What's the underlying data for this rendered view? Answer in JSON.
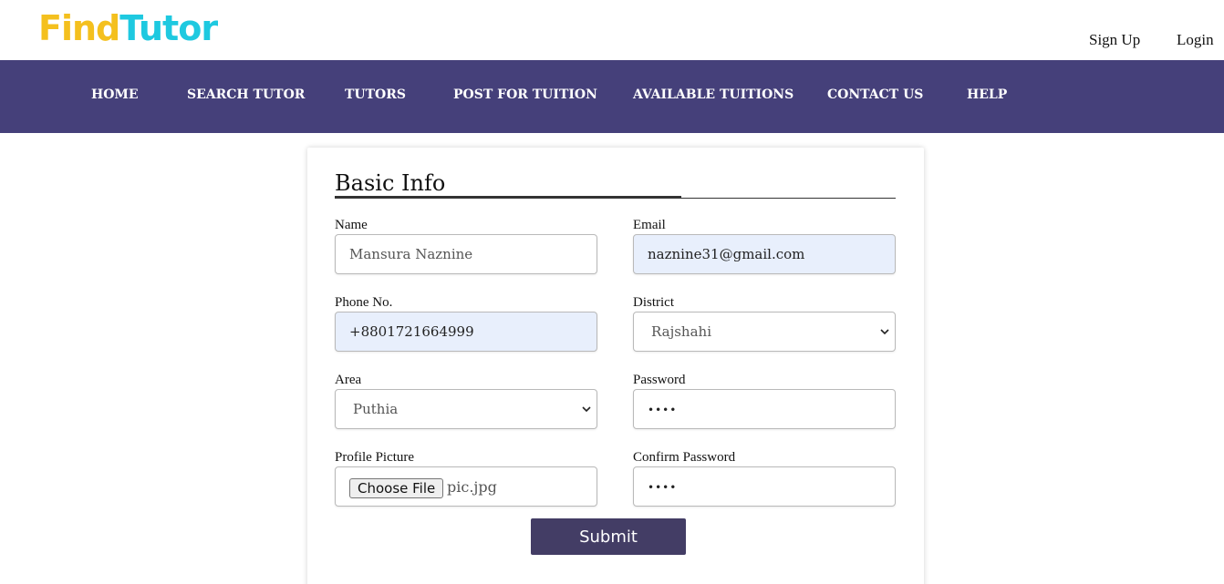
{
  "brand": {
    "part1": "Find",
    "part2": "Tutor"
  },
  "auth": {
    "signup": "Sign Up",
    "login": "Login"
  },
  "nav": [
    "HOME",
    "SEARCH TUTOR",
    "TUTORS",
    "POST FOR TUITION",
    "AVAILABLE TUITIONS",
    "CONTACT US",
    "HELP"
  ],
  "form": {
    "title": "Basic Info",
    "name": {
      "label": "Name",
      "value": "Mansura Naznine"
    },
    "email": {
      "label": "Email",
      "value": "naznine31@gmail.com"
    },
    "phone": {
      "label": "Phone No.",
      "value": "+8801721664999"
    },
    "district": {
      "label": "District",
      "value": "Rajshahi"
    },
    "area": {
      "label": "Area",
      "value": "Puthia"
    },
    "password": {
      "label": "Password",
      "value": "••••"
    },
    "profile": {
      "label": "Profile Picture",
      "button": "Choose File",
      "file": "pic.jpg"
    },
    "confirm": {
      "label": "Confirm Password",
      "value": "••••"
    },
    "submit": "Submit"
  },
  "colors": {
    "nav_bg": "#45407a",
    "logo_yellow": "#f4c01e",
    "logo_cyan": "#1ec9e0",
    "autofill": "#e8effc",
    "button": "#433d65"
  }
}
